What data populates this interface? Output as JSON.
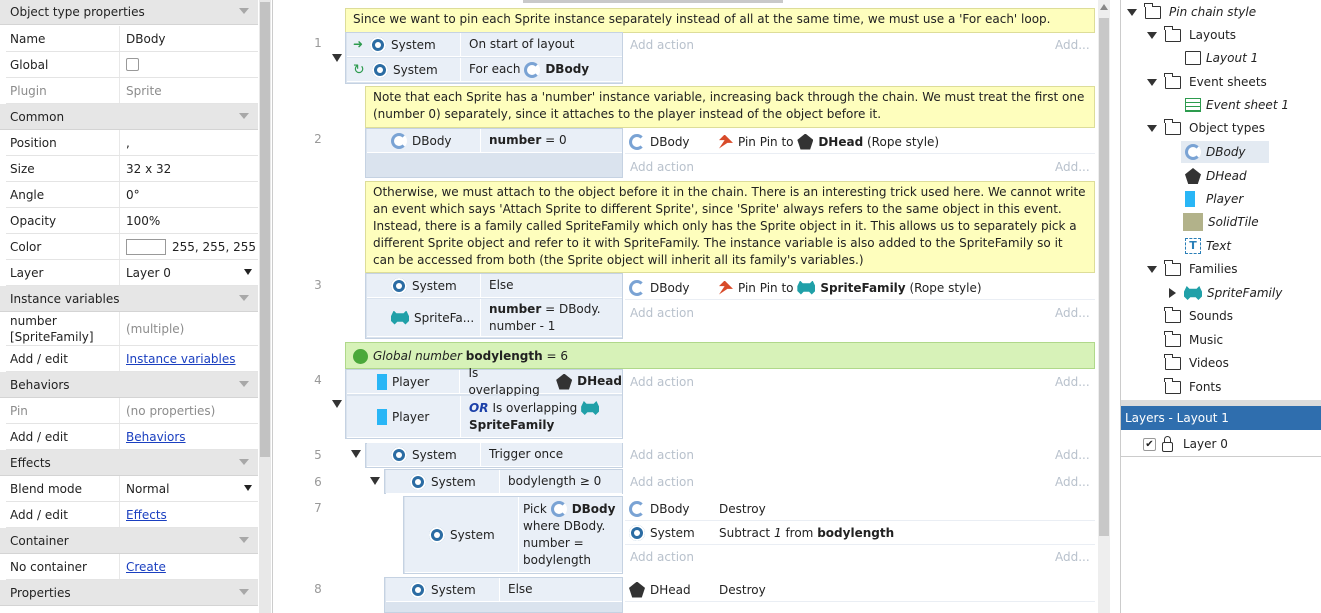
{
  "props": {
    "rows": [
      {
        "k": "sec",
        "label": "Object type properties"
      },
      {
        "k": "row",
        "label": "Name",
        "value": "DBody"
      },
      {
        "k": "row",
        "label": "Global",
        "value": "",
        "check": true
      },
      {
        "k": "row",
        "label": "Plugin",
        "value": "Sprite",
        "muted": true
      },
      {
        "k": "sec",
        "label": "Common"
      },
      {
        "k": "row",
        "label": "Position",
        "value": ",",
        "expand": true
      },
      {
        "k": "row",
        "label": "Size",
        "value": "32 x 32",
        "expand": true
      },
      {
        "k": "row",
        "label": "Angle",
        "value": "0°"
      },
      {
        "k": "row",
        "label": "Opacity",
        "value": "100%"
      },
      {
        "k": "row",
        "label": "Color",
        "value": "255, 255, 255",
        "swatch": true
      },
      {
        "k": "row",
        "label": "Layer",
        "value": "Layer 0",
        "dropdown": true
      },
      {
        "k": "sec",
        "label": "Instance variables"
      },
      {
        "k": "row",
        "label": "number\n[SpriteFamily]",
        "value": "(multiple)",
        "muted": true,
        "tall": true
      },
      {
        "k": "row",
        "label": "Add / edit",
        "value": "Instance variables",
        "link": true
      },
      {
        "k": "sec",
        "label": "Behaviors"
      },
      {
        "k": "row",
        "label": "Pin",
        "value": "(no properties)",
        "muted": true
      },
      {
        "k": "row",
        "label": "Add / edit",
        "value": "Behaviors",
        "link": true
      },
      {
        "k": "sec",
        "label": "Effects"
      },
      {
        "k": "row",
        "label": "Blend mode",
        "value": "Normal",
        "dropdown": true
      },
      {
        "k": "row",
        "label": "Add / edit",
        "value": "Effects",
        "link": true
      },
      {
        "k": "sec",
        "label": "Container"
      },
      {
        "k": "row",
        "label": "No container",
        "value": "Create",
        "link": true
      },
      {
        "k": "sec",
        "label": "Properties"
      }
    ]
  },
  "events": {
    "note1": "Since we want to pin each Sprite instance separately instead of all at the same time, we must use a 'For each' loop.",
    "note2": "Note that each Sprite has a 'number' instance variable, increasing back through the chain.  We must treat the first one (number 0) separately, since it attaches to the player instead of the object before it.",
    "note3": "Otherwise, we must attach to the object before it in the chain.  There is an interesting trick used here.  We cannot write an event which says 'Attach Sprite to different Sprite', since 'Sprite' always refers to the same object in this event.  Instead, there is a family called SpriteFamily which only has the Sprite object in it.  This allows us to separately pick a different Sprite object and refer to it with SpriteFamily.  The instance variable is also added to the SpriteFamily so it can be accessed from both (the Sprite object will inherit all its family's variables.)",
    "global_kw": "Global number",
    "global_name": "bodylength",
    "global_val": "= 6",
    "add_action": "Add action",
    "add_dots": "Add...",
    "lines": [
      "1",
      "2",
      "3",
      "4",
      "5",
      "6",
      "7",
      "8"
    ],
    "e1": {
      "c1_obj": "System",
      "c1_txt": "On start of layout",
      "c2_obj": "System",
      "c2_pre": "For each",
      "c2_name": "DBody"
    },
    "e2": {
      "c_obj": "DBody",
      "c_var": "number",
      "c_rest": "= 0",
      "a_obj": "DBody",
      "a_pre": "Pin Pin to",
      "a_name": "DHead",
      "a_post": "(Rope style)"
    },
    "e3": {
      "c1_obj": "System",
      "c1_txt": "Else",
      "c2_obj": "SpriteFa...",
      "c2_var": "number",
      "c2_rest": "= DBody.",
      "c2_rest2": "number - 1",
      "a_obj": "DBody",
      "a_pre": "Pin Pin to",
      "a_name": "SpriteFamily",
      "a_post": "(Rope style)"
    },
    "e4": {
      "c1_obj": "Player",
      "c1_txt": "Is overlapping",
      "c1_name": "DHead",
      "c2_obj": "Player",
      "c2_or": "OR",
      "c2_txt": "Is overlapping",
      "c2_name": "SpriteFamily"
    },
    "e5": {
      "obj": "System",
      "txt": "Trigger once"
    },
    "e6": {
      "obj": "System",
      "txt": "bodylength ≥ 0"
    },
    "e7": {
      "obj": "System",
      "pick": "Pick",
      "pick_name": "DBody",
      "l2": "where DBody.",
      "l3": "number =",
      "l4": "bodylength",
      "a1_obj": "DBody",
      "a1_txt": "Destroy",
      "a2_obj": "System",
      "a2_pre": "Subtract",
      "a2_num": "1",
      "a2_mid": "from",
      "a2_name": "bodylength"
    },
    "e8": {
      "obj": "System",
      "txt": "Else",
      "a_obj": "DHead",
      "a_txt": "Destroy"
    }
  },
  "project": {
    "root": "Pin chain style",
    "layouts": "Layouts",
    "layout1": "Layout 1",
    "eventsheets": "Event sheets",
    "sheet1": "Event sheet 1",
    "objtypes": "Object types",
    "types": [
      "DBody",
      "DHead",
      "Player",
      "SolidTile",
      "Text"
    ],
    "families": "Families",
    "family1": "SpriteFamily",
    "sounds": "Sounds",
    "music": "Music",
    "videos": "Videos",
    "fonts": "Fonts"
  },
  "layers": {
    "title": "Layers - Layout 1",
    "layer0": "Layer 0"
  }
}
